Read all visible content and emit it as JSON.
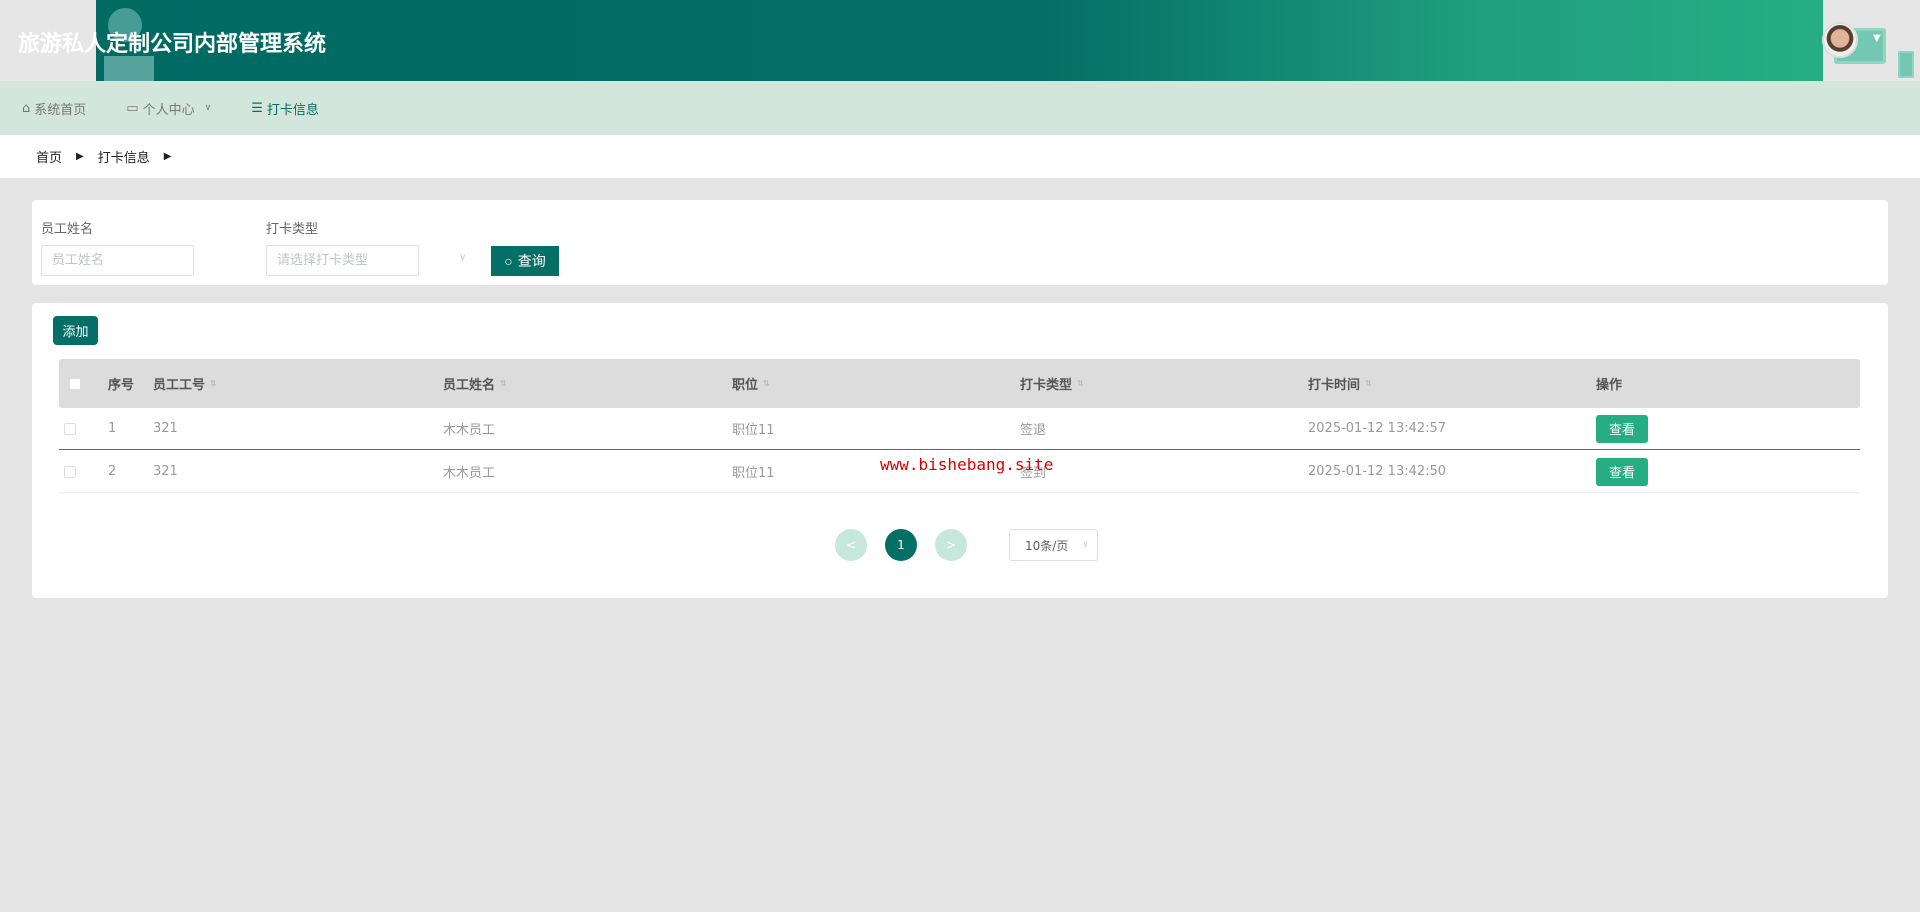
{
  "app": {
    "title": "旅游私人定制公司内部管理系统"
  },
  "nav": {
    "items": [
      {
        "label": "系统首页",
        "icon": "home-icon"
      },
      {
        "label": "个人中心",
        "icon": "card-icon"
      },
      {
        "label": "打卡信息",
        "icon": "menu-icon"
      }
    ]
  },
  "breadcrumb": [
    "首页",
    "打卡信息"
  ],
  "search": {
    "name_label": "员工姓名",
    "name_placeholder": "员工姓名",
    "type_label": "打卡类型",
    "type_placeholder": "请选择打卡类型",
    "query_label": "查询"
  },
  "toolbar": {
    "add_label": "添加"
  },
  "table": {
    "columns": [
      "序号",
      "员工工号",
      "员工姓名",
      "职位",
      "打卡类型",
      "打卡时间",
      "操作"
    ],
    "rows": [
      {
        "index": "1",
        "emp_no": "321",
        "name": "木木员工",
        "position": "职位11",
        "type": "签退",
        "time": "2025-01-12 13:42:57",
        "action": "查看"
      },
      {
        "index": "2",
        "emp_no": "321",
        "name": "木木员工",
        "position": "职位11",
        "type": "签到",
        "time": "2025-01-12 13:42:50",
        "action": "查看"
      }
    ]
  },
  "pagination": {
    "prev": "<",
    "current": "1",
    "next": ">",
    "page_size": "10条/页"
  },
  "watermark": "www.bishebang.site",
  "colors": {
    "primary": "#046f66",
    "accent": "#26ae82",
    "nav_bg": "#d3e6dc"
  }
}
